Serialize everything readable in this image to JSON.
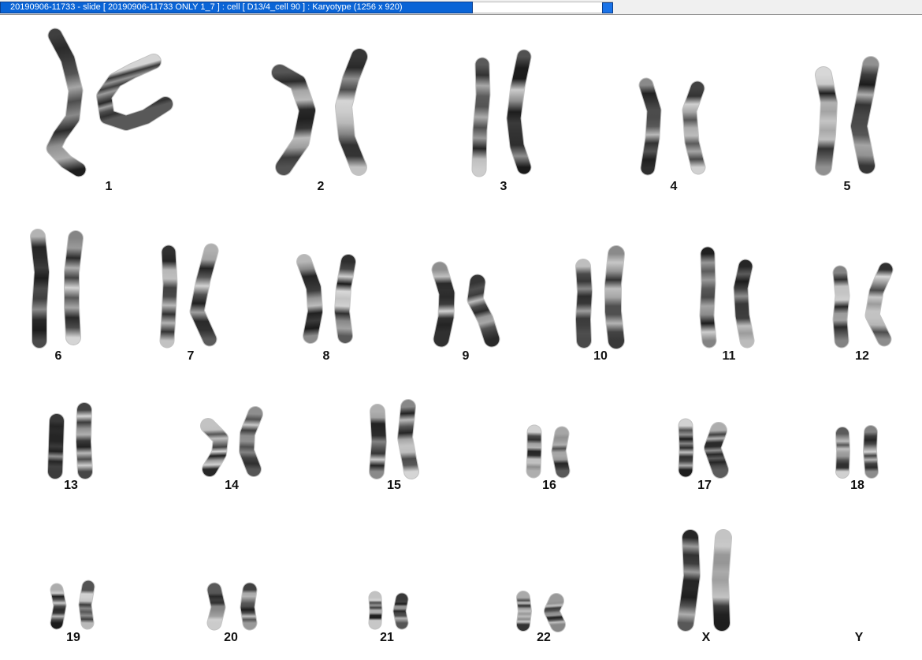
{
  "window": {
    "title": "20190906-11733 - slide [ 20190906-11733 ONLY 1_7 ] : cell [ D13/4_cell 90 ] : Karyotype  (1256 x 920)"
  },
  "colors": {
    "title_bar": "#0a64d6",
    "title_text": "#ffffff",
    "chromosome_dark": "#1a1a1a",
    "chromosome_light": "#d8d8d8"
  },
  "karyotype": {
    "labels": [
      "1",
      "2",
      "3",
      "4",
      "5",
      "6",
      "7",
      "8",
      "9",
      "10",
      "11",
      "12",
      "13",
      "14",
      "15",
      "16",
      "17",
      "18",
      "19",
      "20",
      "21",
      "22",
      "X",
      "Y"
    ]
  }
}
